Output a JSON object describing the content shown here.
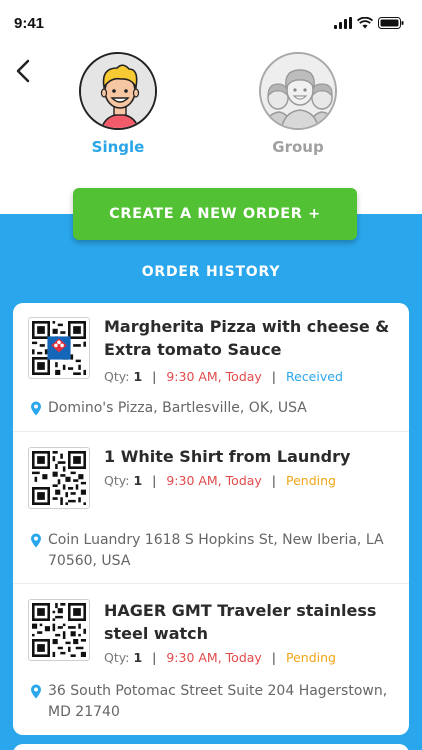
{
  "status": {
    "time": "9:41"
  },
  "modes": {
    "single_label": "Single",
    "group_label": "Group"
  },
  "create_button": "CREATE A NEW ORDER +",
  "history_title": "ORDER HISTORY",
  "orders": [
    {
      "title": "Margherita Pizza with cheese & Extra tomato Sauce",
      "qty_label": "Qty:",
      "qty": "1",
      "time": "9:30 AM, Today",
      "status": "Received",
      "address": "Domino's Pizza, Bartlesville, OK, USA"
    },
    {
      "title": "1 White Shirt from Laundry",
      "qty_label": "Qty:",
      "qty": "1",
      "time": "9:30 AM, Today",
      "status": "Pending",
      "address": "Coin Luandry 1618 S Hopkins St, New Iberia, LA 70560, USA"
    },
    {
      "title": "HAGER GMT Traveler stainless steel watch",
      "qty_label": "Qty:",
      "qty": "1",
      "time": "9:30 AM, Today",
      "status": "Pending",
      "address": "36 South Potomac Street Suite 204 Hagerstown, MD 21740"
    }
  ],
  "separator": "|",
  "colors": {
    "accent_blue": "#2aa7ec",
    "green": "#52c234",
    "time_red": "#e24a4a",
    "pending_orange": "#f2a516"
  },
  "icons": [
    "back-chevron-icon",
    "signal-icon",
    "wifi-icon",
    "battery-icon",
    "location-pin-icon",
    "qr-code-icon"
  ]
}
